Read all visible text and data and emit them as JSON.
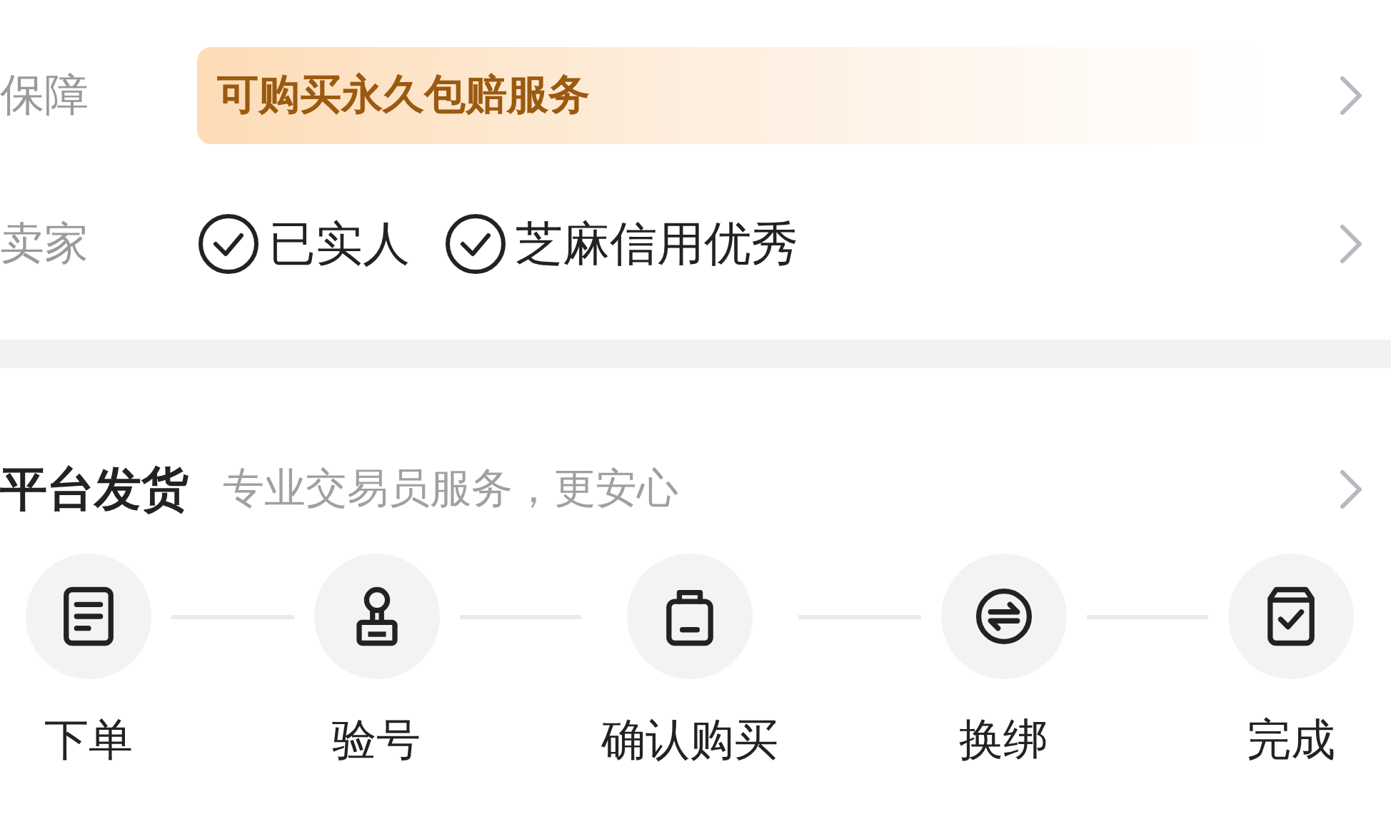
{
  "guarantee": {
    "label": "保障",
    "banner": "可购买永久包赔服务"
  },
  "seller": {
    "label": "卖家",
    "badges": [
      "已实人",
      "芝麻信用优秀"
    ]
  },
  "platform_delivery": {
    "title": "平台发货",
    "subtitle": "专业交易员服务，更安心",
    "steps": [
      {
        "kind": "order",
        "label": "下单"
      },
      {
        "kind": "verify",
        "label": "验号"
      },
      {
        "kind": "purchase",
        "label": "确认购买"
      },
      {
        "kind": "rebind",
        "label": "换绑"
      },
      {
        "kind": "done",
        "label": "完成"
      }
    ]
  }
}
